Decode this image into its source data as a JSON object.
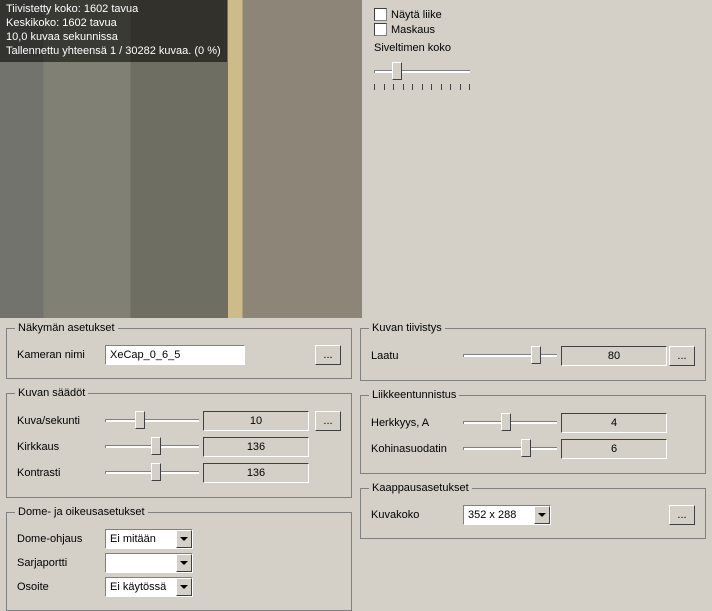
{
  "preview_overlay": {
    "l1": "Tiivistetty koko: 1602 tavua",
    "l2": "Keskikoko: 1602 tavua",
    "l3": "10,0 kuvaa sekunnissa",
    "l4": "Tallennettu yhteensä 1 / 30282 kuvaa. (0 %)"
  },
  "top_panel": {
    "show_motion": "Näytä liike",
    "masking": "Maskaus",
    "brush_size_label": "Siveltimen koko"
  },
  "view_settings": {
    "legend": "Näkymän asetukset",
    "camera_name_label": "Kameran nimi",
    "camera_name_value": "XeCap_0_6_5",
    "ellipsis": "..."
  },
  "image_adjust": {
    "legend": "Kuvan säädöt",
    "fps_label": "Kuva/sekunti",
    "fps_value": "10",
    "brightness_label": "Kirkkaus",
    "brightness_value": "136",
    "contrast_label": "Kontrasti",
    "contrast_value": "136",
    "ellipsis": "..."
  },
  "dome": {
    "legend": "Dome- ja oikeusasetukset",
    "dome_label": "Dome-ohjaus",
    "dome_value": "Ei mitään",
    "serial_label": "Sarjaportti",
    "serial_value": "",
    "addr_label": "Osoite",
    "addr_value": "Ei käytössä"
  },
  "compression": {
    "legend": "Kuvan tiivistys",
    "quality_label": "Laatu",
    "quality_value": "80",
    "ellipsis": "..."
  },
  "motion": {
    "legend": "Liikkeentunnistus",
    "sensitivity_label": "Herkkyys, A",
    "sensitivity_value": "4",
    "noise_label": "Kohinasuodatin",
    "noise_value": "6"
  },
  "capture": {
    "legend": "Kaappausasetukset",
    "size_label": "Kuvakoko",
    "size_value": "352 x 288",
    "ellipsis": "..."
  }
}
